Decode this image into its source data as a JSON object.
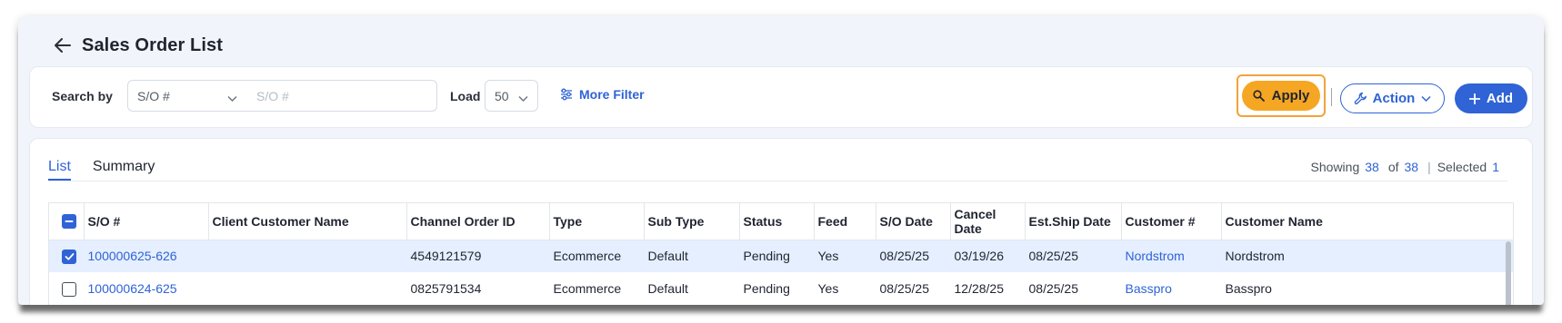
{
  "header": {
    "title": "Sales Order List"
  },
  "filters": {
    "search_by_label": "Search by",
    "search_field_value": "S/O #",
    "search_input_placeholder": "S/O #",
    "load_label": "Load",
    "load_value": "50",
    "more_filter_label": "More Filter",
    "apply_label": "Apply",
    "action_label": "Action",
    "add_label": "Add"
  },
  "tabs": [
    {
      "label": "List",
      "active": true
    },
    {
      "label": "Summary",
      "active": false
    }
  ],
  "summary": {
    "showing_label": "Showing",
    "showing_count": "38",
    "of_label": "of",
    "total_count": "38",
    "selected_label": "Selected",
    "selected_count": "1"
  },
  "table": {
    "columns": [
      "S/O #",
      "Client Customer Name",
      "Channel Order ID",
      "Type",
      "Sub Type",
      "Status",
      "Feed",
      "S/O Date",
      "Cancel Date",
      "Est.Ship Date",
      "Customer #",
      "Customer Name"
    ],
    "rows": [
      {
        "checked": true,
        "so": "100000625-626",
        "client_customer_name": "",
        "channel_order_id": "4549121579",
        "type": "Ecommerce",
        "sub_type": "Default",
        "status": "Pending",
        "feed": "Yes",
        "so_date": "08/25/25",
        "cancel_date": "03/19/26",
        "est_ship_date": "08/25/25",
        "customer_no": "Nordstrom",
        "customer_name": "Nordstrom"
      },
      {
        "checked": false,
        "so": "100000624-625",
        "client_customer_name": "",
        "channel_order_id": "0825791534",
        "type": "Ecommerce",
        "sub_type": "Default",
        "status": "Pending",
        "feed": "Yes",
        "so_date": "08/25/25",
        "cancel_date": "12/28/25",
        "est_ship_date": "08/25/25",
        "customer_no": "Basspro",
        "customer_name": "Basspro"
      }
    ]
  },
  "colors": {
    "accent": "#2f63d6",
    "apply": "#f5a623",
    "selected_row": "#e5efff"
  }
}
